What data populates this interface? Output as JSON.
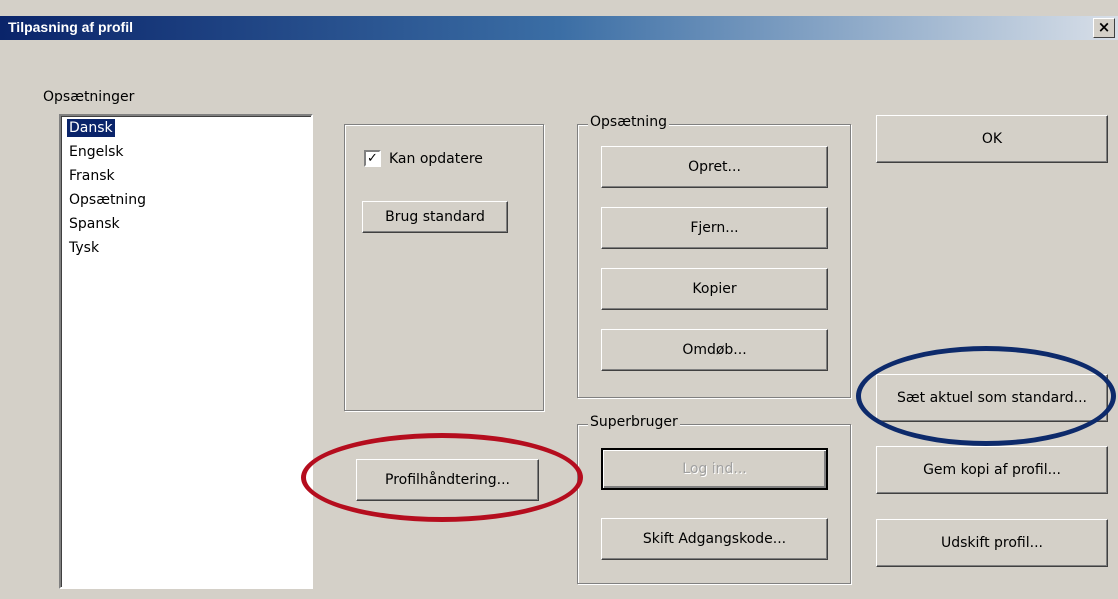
{
  "window": {
    "title": "Tilpasning af profil",
    "close_label": "×"
  },
  "opsaetninger": {
    "label": "Opsætninger",
    "items": [
      {
        "label": "Dansk",
        "selected": true
      },
      {
        "label": "Engelsk",
        "selected": false
      },
      {
        "label": "Fransk",
        "selected": false
      },
      {
        "label": "Opsætning",
        "selected": false
      },
      {
        "label": "Spansk",
        "selected": false
      },
      {
        "label": "Tysk",
        "selected": false
      }
    ]
  },
  "settings_panel": {
    "checkbox_label": "Kan opdatere",
    "checkbox_checked": true,
    "checkmark": "✓",
    "use_default_button": "Brug standard"
  },
  "opsaetning_group": {
    "label": "Opsætning",
    "create_button": "Opret...",
    "remove_button": "Fjern...",
    "copy_button": "Kopier",
    "rename_button": "Omdøb..."
  },
  "superbruger_group": {
    "label": "Superbruger",
    "login_button": "Log ind...",
    "change_password_button": "Skift Adgangskode..."
  },
  "profile_management_button": "Profilhåndtering...",
  "right_buttons": {
    "ok": "OK",
    "set_default": "Sæt aktuel som standard...",
    "save_copy": "Gem kopi af profil...",
    "replace_profile": "Udskift profil..."
  },
  "highlight_colors": {
    "red": "#b50d1e",
    "blue": "#0d2a6b"
  }
}
